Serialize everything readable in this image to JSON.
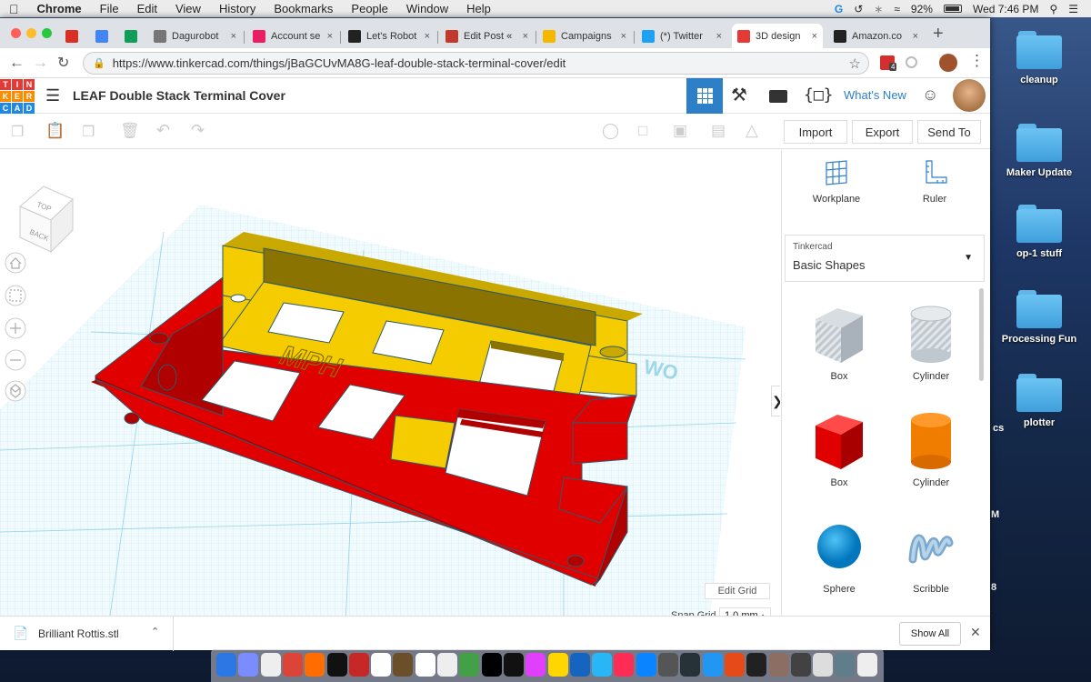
{
  "menubar": {
    "app": "Chrome",
    "items": [
      "File",
      "Edit",
      "View",
      "History",
      "Bookmarks",
      "People",
      "Window",
      "Help"
    ],
    "battery": "92%",
    "clock": "Wed 7:46 PM"
  },
  "desktop": {
    "icons": [
      "cleanup",
      "Maker Update",
      "op-1 stuff",
      "Processing Fun",
      "plotter"
    ],
    "partial_labels": [
      "cs",
      "M",
      "8"
    ]
  },
  "tabs": [
    {
      "label": "",
      "color": "#d93025"
    },
    {
      "label": "",
      "color": "#4285f4"
    },
    {
      "label": "",
      "color": "#0f9d58"
    },
    {
      "label": "Dagurobot",
      "color": "#777777"
    },
    {
      "label": "Account se",
      "color": "#e91e63"
    },
    {
      "label": "Let's Robot",
      "color": "#222222"
    },
    {
      "label": "Edit Post «",
      "color": "#c0392b"
    },
    {
      "label": "Campaigns",
      "color": "#f5b800"
    },
    {
      "label": "(*) Twitter",
      "color": "#1da1f2"
    },
    {
      "label": "3D design",
      "color": "#e53935"
    },
    {
      "label": "Amazon.co",
      "color": "#222222"
    }
  ],
  "browser": {
    "url": "https://www.tinkercad.com/things/jBaGCUvMA8G-leaf-double-stack-terminal-cover/edit",
    "ext_badge": "4"
  },
  "tinkercad": {
    "logo": [
      "TIN",
      "KER",
      "CAD"
    ],
    "title": "LEAF Double Stack Terminal Cover",
    "whats_new": "What's New",
    "import": "Import",
    "export": "Export",
    "send_to": "Send To",
    "workplane": "Workplane",
    "ruler": "Ruler",
    "library_small": "Tinkercad",
    "library": "Basic Shapes",
    "shapes": [
      "Box",
      "Cylinder",
      "Box",
      "Cylinder",
      "Sphere",
      "Scribble"
    ],
    "edit_grid": "Edit Grid",
    "snap_grid_label": "Snap Grid",
    "snap_grid_value": "1.0 mm",
    "viewcube_top": "TOP",
    "viewcube_back": "BACK",
    "model_text": "MPH"
  },
  "download": {
    "file": "Brilliant Rottis.stl",
    "show_all": "Show All"
  },
  "colors": {
    "red": "#e00000",
    "yellow": "#f4cc00",
    "grid": "#6fc4dc",
    "accent": "#2d7fc8"
  }
}
